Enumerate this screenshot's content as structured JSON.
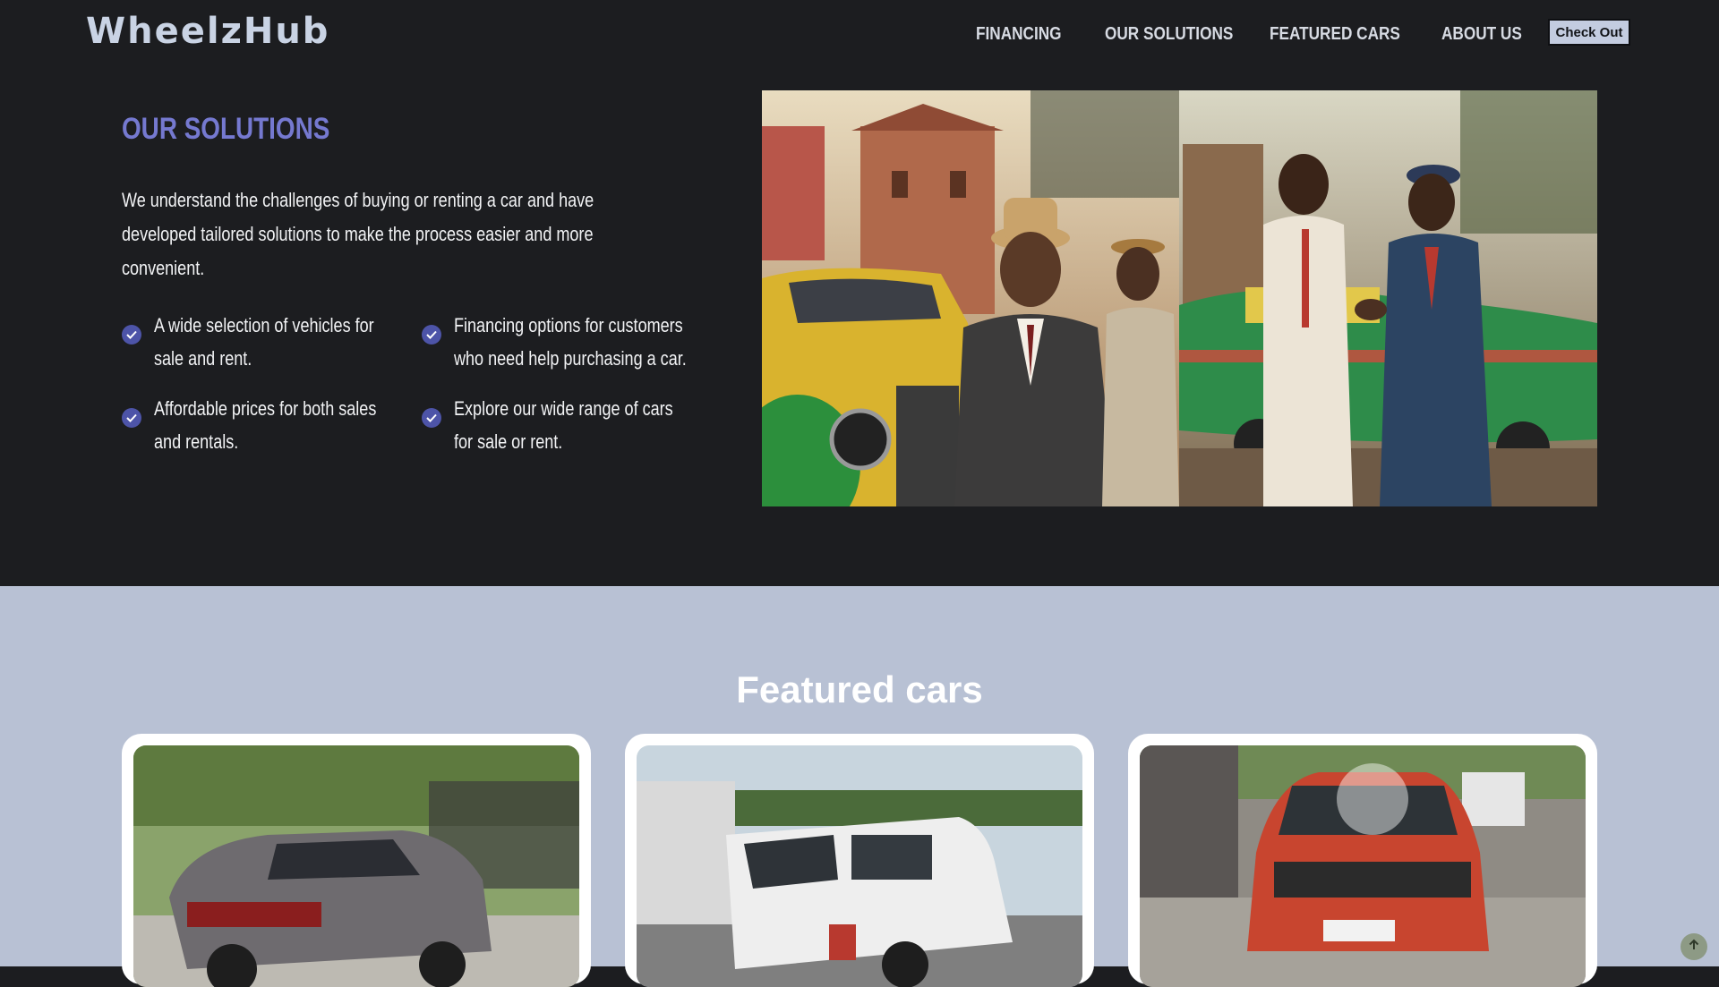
{
  "header": {
    "logo": "WheelzHub",
    "nav": [
      "FINANCING",
      "OUR SOLUTIONS",
      "FEATURED CARS",
      "ABOUT US"
    ],
    "checkout_label": "Check Out"
  },
  "solutions": {
    "title": "OUR SOLUTIONS",
    "description": "We understand the challenges of buying or renting a car and have developed tailored solutions to make the process easier and more convenient.",
    "features": [
      "A wide selection of vehicles for sale and rent.",
      "Financing options for customers who need help purchasing a car.",
      "Affordable prices for both sales and rentals.",
      "Explore our wide range of cars for sale or rent."
    ],
    "check_icon": "check-circle-icon"
  },
  "featured": {
    "title": "Featured cars",
    "cards": [
      {
        "car_color": "gray hatchback"
      },
      {
        "car_color": "white suv"
      },
      {
        "car_color": "red suv"
      }
    ]
  },
  "colors": {
    "background_dark": "#1c1d20",
    "accent": "#7579d0",
    "featured_bg": "#b8c1d4"
  },
  "scroll_top_icon": "arrow-up-icon"
}
